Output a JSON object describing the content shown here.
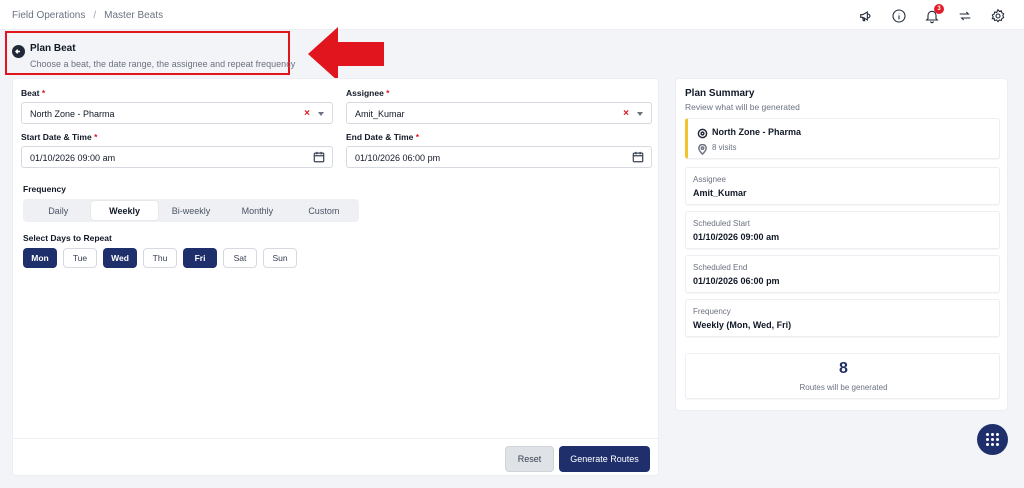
{
  "breadcrumb": {
    "items": [
      "Field Operations",
      "Master Beats"
    ],
    "separator": "/"
  },
  "header_icons": [
    "megaphone-icon",
    "info-icon",
    "bell-icon",
    "sync-icon",
    "gear-icon"
  ],
  "notifications": {
    "count": "3"
  },
  "page": {
    "title": "Plan Beat",
    "subtitle": "Choose a beat, the date range, the assignee and repeat frequency"
  },
  "form": {
    "beat": {
      "label": "Beat",
      "required": "*",
      "value": "North Zone - Pharma",
      "clear": "×"
    },
    "assignee": {
      "label": "Assignee",
      "required": "*",
      "value": "Amit_Kumar",
      "clear": "×"
    },
    "start": {
      "label": "Start Date & Time",
      "required": "*",
      "value": "01/10/2026 09:00 am"
    },
    "end": {
      "label": "End Date & Time",
      "required": "*",
      "value": "01/10/2026 06:00 pm"
    },
    "frequency": {
      "label": "Frequency",
      "options": [
        "Daily",
        "Weekly",
        "Bi-weekly",
        "Monthly",
        "Custom"
      ],
      "selected": "Weekly"
    },
    "days": {
      "label": "Select Days to Repeat",
      "options": [
        "Mon",
        "Tue",
        "Wed",
        "Thu",
        "Fri",
        "Sat",
        "Sun"
      ],
      "selected": [
        "Mon",
        "Wed",
        "Fri"
      ]
    }
  },
  "actions": {
    "reset": "Reset",
    "generate": "Generate Routes"
  },
  "summary": {
    "title": "Plan Summary",
    "subtitle": "Review what will be generated",
    "beat_name": "North Zone - Pharma",
    "visits": "8 visits",
    "assignee_label": "Assignee",
    "assignee_value": "Amit_Kumar",
    "start_label": "Scheduled Start",
    "start_value": "01/10/2026 09:00 am",
    "end_label": "Scheduled End",
    "end_value": "01/10/2026 06:00 pm",
    "frequency_label": "Frequency",
    "frequency_value": "Weekly (Mon, Wed, Fri)",
    "routes_count": "8",
    "routes_label": "Routes will be generated"
  },
  "colors": {
    "primary": "#1f2f6b",
    "highlight": "#e0151e",
    "beat_accent": "#f2c230"
  }
}
